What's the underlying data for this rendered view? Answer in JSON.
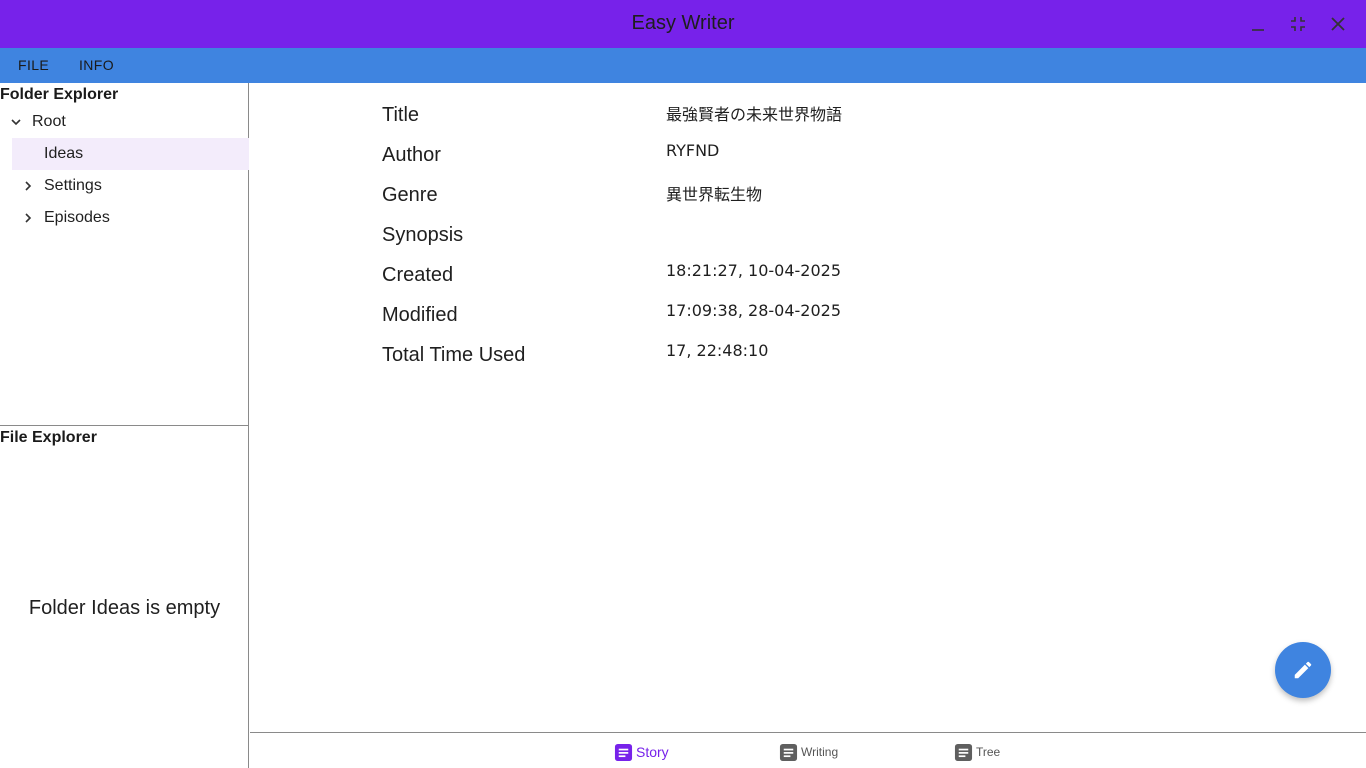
{
  "window": {
    "title": "Easy Writer",
    "controls": [
      "minimize-icon",
      "restore-icon",
      "close-icon"
    ]
  },
  "menu": {
    "file": "FILE",
    "info": "INFO"
  },
  "folder_explorer": {
    "title": "Folder Explorer",
    "root": "Root",
    "items": [
      {
        "label": "Ideas",
        "selected": true
      },
      {
        "label": "Settings",
        "expandable": true
      },
      {
        "label": "Episodes",
        "expandable": true
      }
    ]
  },
  "file_explorer": {
    "title": "File Explorer",
    "empty_message": "Folder Ideas is empty"
  },
  "story_info": {
    "title_label": "Title",
    "title_value": "最強賢者の未来世界物語",
    "author_label": "Author",
    "author_value": "RYFND",
    "genre_label": "Genre",
    "genre_value": "異世界転生物",
    "synopsis_label": "Synopsis",
    "synopsis_value": "",
    "created_label": "Created",
    "created_value": "18:21:27, 10-04-2025",
    "modified_label": "Modified",
    "modified_value": "17:09:38, 28-04-2025",
    "time_label": "Total Time Used",
    "time_value": "17, 22:48:10"
  },
  "fab": {
    "icon": "pencil-icon"
  },
  "bottom_nav": [
    {
      "label": "Story",
      "icon": "document-icon",
      "active": true
    },
    {
      "label": "Writing",
      "icon": "document-icon",
      "active": false
    },
    {
      "label": "Tree",
      "icon": "document-icon",
      "active": false
    }
  ],
  "colors": {
    "titlebar": "#7722ea",
    "menubar": "#3f84e0",
    "accent": "#7722ea",
    "fab": "#3f84e0",
    "selected_row": "#f3ecfb"
  }
}
